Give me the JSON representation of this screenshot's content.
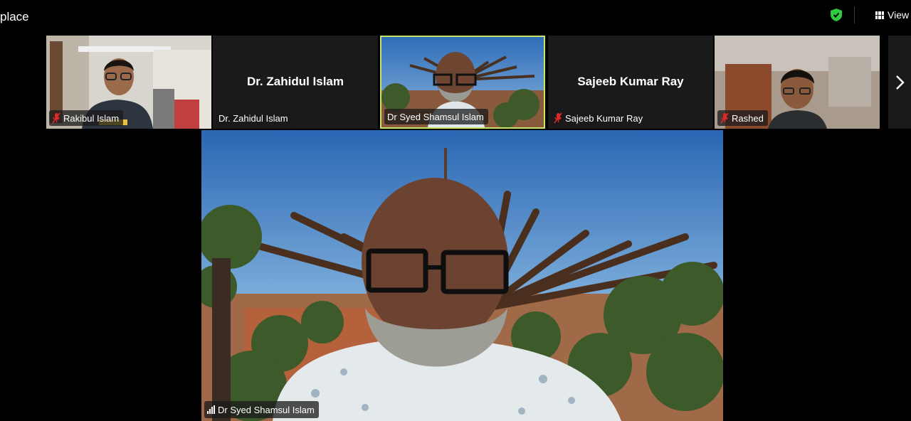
{
  "window": {
    "title": "place"
  },
  "header": {
    "view_label": "View",
    "security_icon": "shield-check-icon",
    "view_icon": "grid-icon"
  },
  "colors": {
    "active_speaker_border": "#c7e36a",
    "mic_muted": "#e02828",
    "shield": "#2ecc40"
  },
  "participants": [
    {
      "name": "Rakibul Islam",
      "muted": true,
      "video": true
    },
    {
      "name": "Dr. Zahidul Islam",
      "display_name": "Dr. Zahidul Islam",
      "muted": false,
      "video": false
    },
    {
      "name": "Dr Syed Shamsul Islam",
      "muted": false,
      "video": true,
      "active": true
    },
    {
      "name": "Sajeeb Kumar Ray",
      "display_name": "Sajeeb Kumar Ray",
      "muted": true,
      "video": false
    },
    {
      "name": "Rashed",
      "muted": true,
      "video": true
    }
  ],
  "main_video": {
    "name": "Dr Syed Shamsul Islam"
  }
}
